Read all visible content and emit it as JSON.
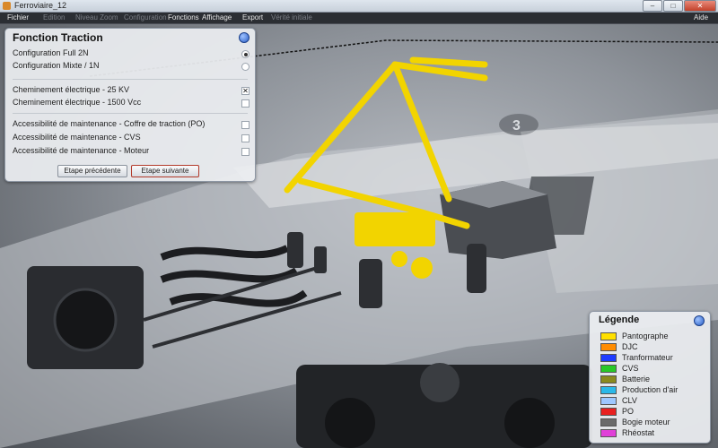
{
  "window": {
    "title": "Ferroviaire_12"
  },
  "menu": {
    "items": [
      {
        "label": "Fichier",
        "enabled": true
      },
      {
        "label": "Edition",
        "enabled": false
      },
      {
        "label": "Niveau Zoom",
        "enabled": false
      },
      {
        "label": "Configuration",
        "enabled": false
      },
      {
        "label": "Fonctions",
        "enabled": true
      },
      {
        "label": "Affichage",
        "enabled": true
      },
      {
        "label": "Export",
        "enabled": true
      },
      {
        "label": "Vérité initiale",
        "enabled": false
      },
      {
        "label": "Aide",
        "enabled": true
      }
    ]
  },
  "panel": {
    "title": "Fonction Traction",
    "configs": [
      {
        "label": "Configuration Full 2N",
        "selected": true
      },
      {
        "label": "Configuration Mixte / 1N",
        "selected": false
      }
    ],
    "paths": [
      {
        "label": "Cheminement électrique - 25 KV",
        "checked": true
      },
      {
        "label": "Cheminement électrique - 1500 Vcc",
        "checked": false
      }
    ],
    "maintenance": [
      {
        "label": "Accessibilité de maintenance - Coffre de traction (PO)",
        "checked": false
      },
      {
        "label": "Accessibilité de maintenance - CVS",
        "checked": false
      },
      {
        "label": "Accessibilité de maintenance - Moteur",
        "checked": false
      }
    ],
    "prev_label": "Etape précédente",
    "next_label": "Etape suivante"
  },
  "legend": {
    "title": "Légende",
    "items": [
      {
        "label": "Pantographe",
        "color": "#ffe000"
      },
      {
        "label": "DJC",
        "color": "#ff8c00"
      },
      {
        "label": "Tranformateur",
        "color": "#1e3cff"
      },
      {
        "label": "CVS",
        "color": "#28c828"
      },
      {
        "label": "Batterie",
        "color": "#8a8a1e"
      },
      {
        "label": "Production d'air",
        "color": "#2ab8e8"
      },
      {
        "label": "CLV",
        "color": "#9ec8ff"
      },
      {
        "label": "PO",
        "color": "#e82020"
      },
      {
        "label": "Bogie moteur",
        "color": "#6a6a6a"
      },
      {
        "label": "Rhéostat",
        "color": "#e040d8"
      }
    ]
  },
  "scene": {
    "car_number": "3"
  }
}
